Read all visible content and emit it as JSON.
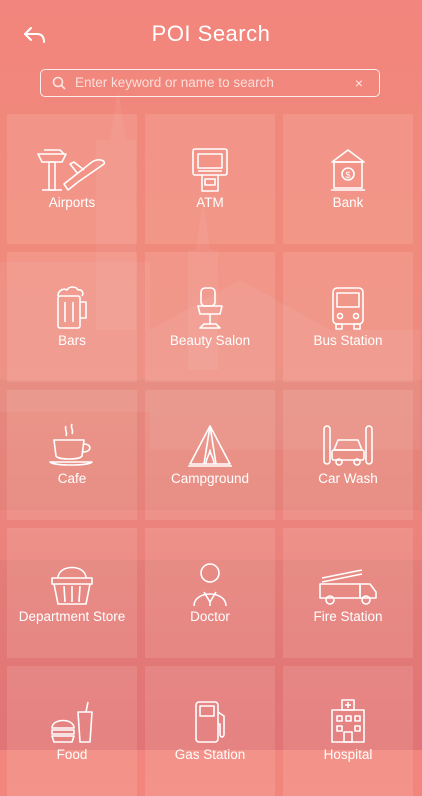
{
  "header": {
    "title": "POI Search",
    "back_icon": "back-arrow-icon"
  },
  "search": {
    "placeholder": "Enter keyword or name to search",
    "value": "",
    "clear_symbol": "×"
  },
  "categories": [
    {
      "label": "Airports",
      "icon": "airport-icon"
    },
    {
      "label": "ATM",
      "icon": "atm-icon"
    },
    {
      "label": "Bank",
      "icon": "bank-icon"
    },
    {
      "label": "Bars",
      "icon": "beer-mug-icon"
    },
    {
      "label": "Beauty Salon",
      "icon": "salon-chair-icon"
    },
    {
      "label": "Bus Station",
      "icon": "bus-icon"
    },
    {
      "label": "Cafe",
      "icon": "coffee-cup-icon"
    },
    {
      "label": "Campground",
      "icon": "tent-icon"
    },
    {
      "label": "Car Wash",
      "icon": "car-wash-icon"
    },
    {
      "label": "Department Store",
      "icon": "shopping-basket-icon"
    },
    {
      "label": "Doctor",
      "icon": "doctor-icon"
    },
    {
      "label": "Fire Station",
      "icon": "fire-truck-icon"
    },
    {
      "label": "Food",
      "icon": "food-icon"
    },
    {
      "label": "Gas Station",
      "icon": "gas-pump-icon"
    },
    {
      "label": "Hospital",
      "icon": "hospital-icon"
    }
  ],
  "colors": {
    "gradient_top": "#f2857d",
    "gradient_bottom": "#e8777a",
    "text": "#ffffff"
  }
}
